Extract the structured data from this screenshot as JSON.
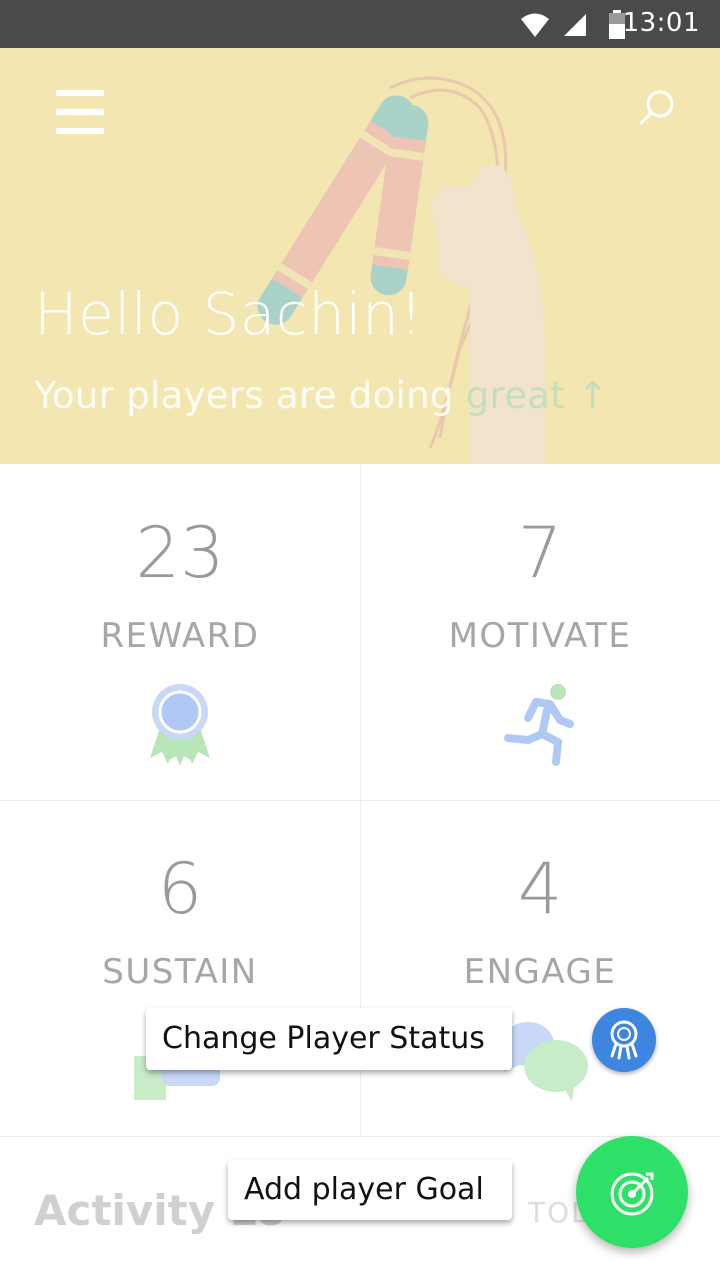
{
  "status_bar": {
    "time": "13:01"
  },
  "header": {
    "greeting": "Hello Sachin!",
    "subtitle_prefix": "Your players are doing ",
    "subtitle_highlight": "great",
    "subtitle_arrow": "↑",
    "background_color": "#f3e6b0"
  },
  "stats": [
    {
      "value": "23",
      "label": "REWARD",
      "icon": "award-ribbon-icon"
    },
    {
      "value": "7",
      "label": "MOTIVATE",
      "icon": "running-person-icon"
    },
    {
      "value": "6",
      "label": "SUSTAIN",
      "icon": "chat-bubbles-icon"
    },
    {
      "value": "4",
      "label": "ENGAGE",
      "icon": "speech-bubbles-icon"
    }
  ],
  "activity": {
    "title": "Activity Lo",
    "today_label": "TOD"
  },
  "speed_dial": {
    "change_status_label": "Change Player Status",
    "add_goal_label": "Add player Goal",
    "mini_fab_icon": "award-icon",
    "fab_icon": "target-icon",
    "mini_fab_color": "#3d85de",
    "fab_color": "#2ee068"
  }
}
